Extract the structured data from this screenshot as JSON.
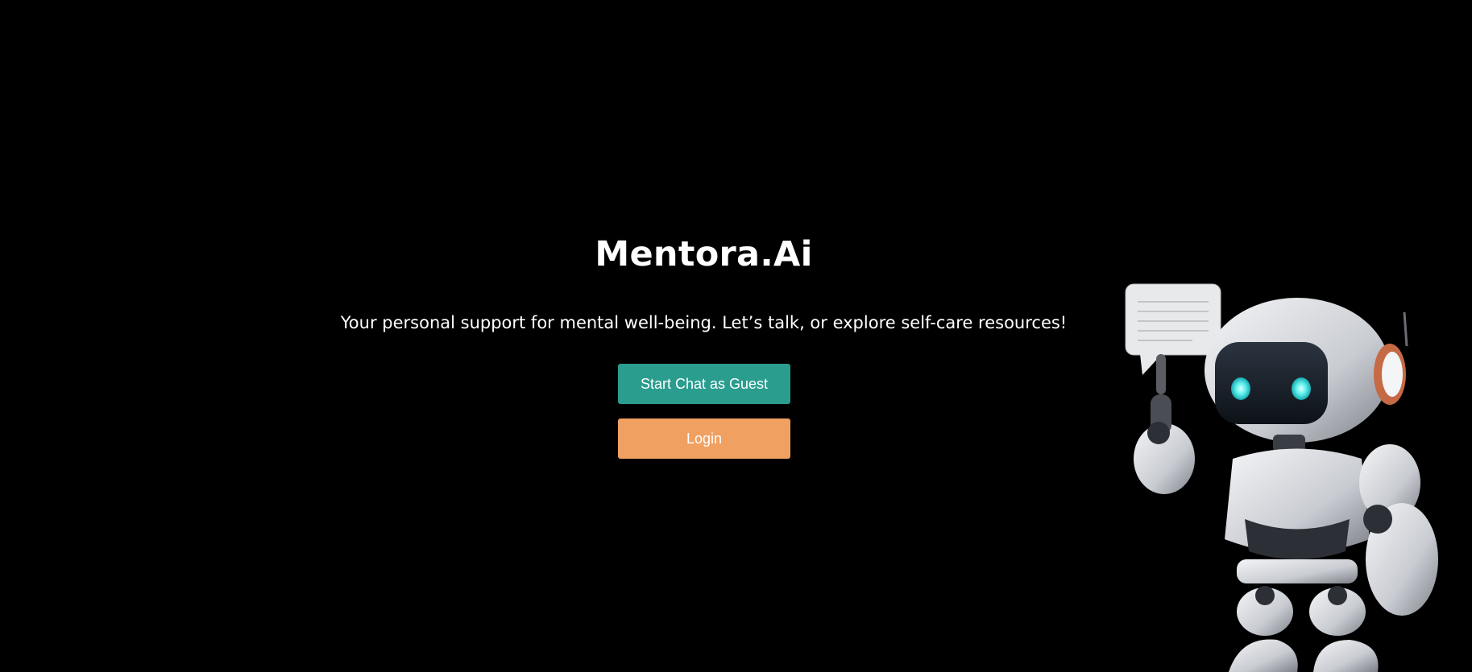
{
  "hero": {
    "title": "Mentora.Ai",
    "tagline": "Your personal support for mental well-being. Let’s talk, or explore self-care resources!"
  },
  "actions": {
    "guest_label": "Start Chat as Guest",
    "login_label": "Login"
  },
  "colors": {
    "background": "#000000",
    "guest_button": "#2a9d8f",
    "login_button": "#f0a060",
    "text": "#ffffff"
  },
  "illustration": {
    "subject": "robot-mascot-with-speech-bubble"
  }
}
